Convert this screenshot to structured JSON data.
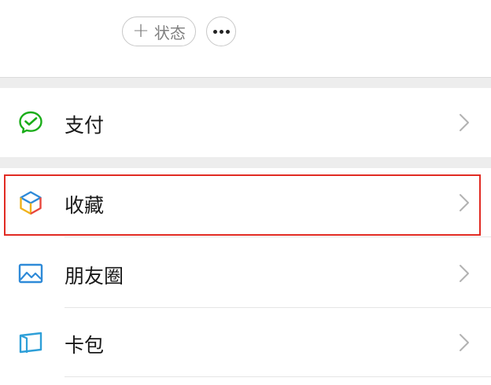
{
  "header": {
    "status_button_label": "状态",
    "status_plus_glyph": "+",
    "more_button_icon": "more-dots-icon"
  },
  "menu": {
    "items": [
      {
        "label": "支付",
        "icon": "wechat-pay-icon",
        "icon_color": "#1aad19"
      },
      {
        "label": "收藏",
        "icon": "favorites-cube-icon",
        "highlighted": true
      },
      {
        "label": "朋友圈",
        "icon": "moments-picture-icon",
        "icon_color": "#2e8ad8"
      },
      {
        "label": "卡包",
        "icon": "card-wallet-icon",
        "icon_color": "#2e9fd8"
      }
    ]
  },
  "colors": {
    "highlight_border": "#e12b23",
    "chevron": "#b2b2b2",
    "separator_background": "#ededed"
  }
}
